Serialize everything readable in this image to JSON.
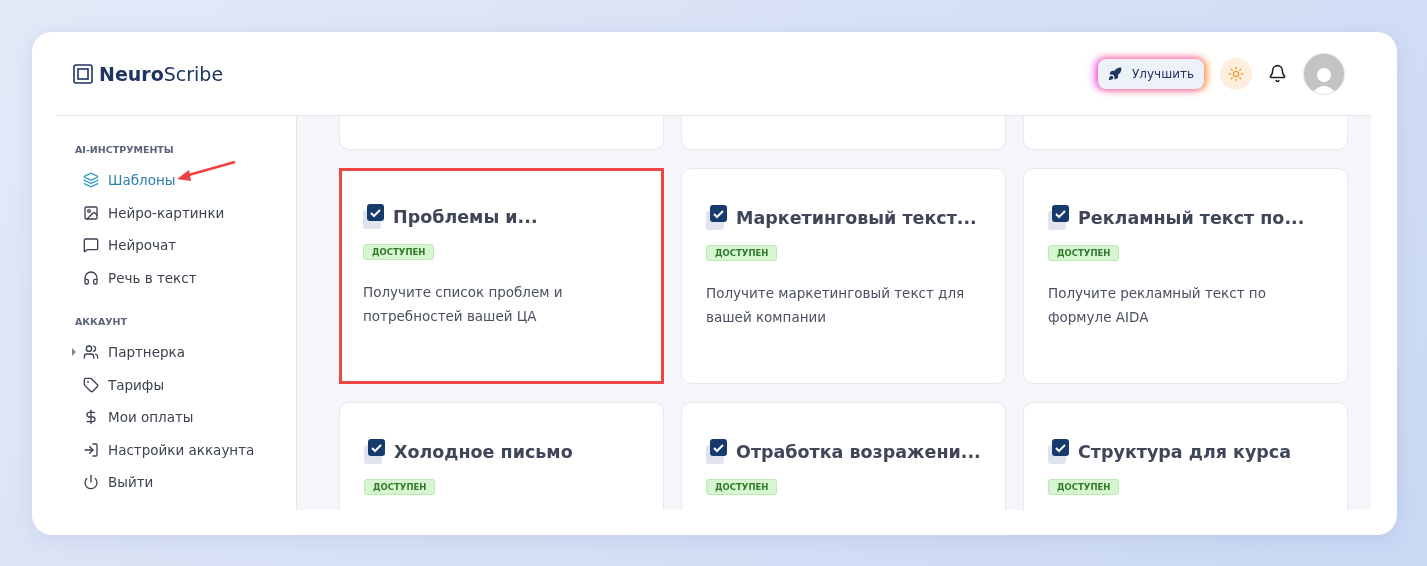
{
  "brand": {
    "bold": "Neuro",
    "light": "Scribe"
  },
  "header": {
    "upgrade_button": "Улучшить"
  },
  "sidebar": {
    "sections": [
      {
        "title": "AI-ИНСТРУМЕНТЫ",
        "items": [
          {
            "label": "Шаблоны",
            "selected": true,
            "pointer_arrow": true,
            "expandable": false
          },
          {
            "label": "Нейро-картинки",
            "selected": false,
            "pointer_arrow": false,
            "expandable": false
          },
          {
            "label": "Нейрочат",
            "selected": false,
            "pointer_arrow": false,
            "expandable": false
          },
          {
            "label": "Речь в текст",
            "selected": false,
            "pointer_arrow": false,
            "expandable": false
          }
        ]
      },
      {
        "title": "АККАУНТ",
        "items": [
          {
            "label": "Партнерка",
            "selected": false,
            "pointer_arrow": false,
            "expandable": true
          },
          {
            "label": "Тарифы",
            "selected": false,
            "pointer_arrow": false,
            "expandable": false
          },
          {
            "label": "Мои оплаты",
            "selected": false,
            "pointer_arrow": false,
            "expandable": false
          },
          {
            "label": "Настройки аккаунта",
            "selected": false,
            "pointer_arrow": false,
            "expandable": false
          },
          {
            "label": "Выйти",
            "selected": false,
            "pointer_arrow": false,
            "expandable": false
          }
        ]
      }
    ]
  },
  "templates": [
    {
      "title": "Проблемы и...",
      "badge": "ДОСТУПЕН",
      "description": "Получите список проблем и потребностей вашей ЦА",
      "highlighted": true
    },
    {
      "title": "Маркетинговый текст...",
      "badge": "ДОСТУПЕН",
      "description": "Получите маркетинговый текст для вашей компании",
      "highlighted": false
    },
    {
      "title": "Рекламный текст по...",
      "badge": "ДОСТУПЕН",
      "description": "Получите рекламный текст по формуле AIDA",
      "highlighted": false
    },
    {
      "title": "Холодное письмо",
      "badge": "ДОСТУПЕН",
      "highlighted": false
    },
    {
      "title": "Отработка возражени...",
      "badge": "ДОСТУПЕН",
      "highlighted": false
    },
    {
      "title": "Структура для курса",
      "badge": "ДОСТУПЕН",
      "highlighted": false
    }
  ]
}
